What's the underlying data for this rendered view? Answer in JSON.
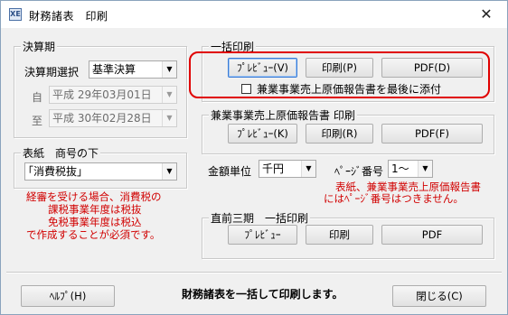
{
  "window": {
    "title": "財務諸表　印刷",
    "app_icon_text": "XE",
    "close_glyph": "✕"
  },
  "fiscal_period": {
    "group_label": "決算期",
    "select_label": "決算期選択",
    "select_value": "基準決算",
    "from_label": "自",
    "from_value": "平成 29年03月01日",
    "to_label": "至",
    "to_value": "平成 30年02月28日"
  },
  "cover": {
    "group_label": "表紙　商号の下",
    "select_value": "｢消費税抜｣"
  },
  "tax_note": {
    "line1": "経審を受ける場合、消費税の",
    "line2": "課税事業年度は税抜",
    "line3": "免税事業年度は税込",
    "line4": "で作成することが必須です。"
  },
  "batch_print": {
    "group_label": "一括印刷",
    "preview": "ﾌﾟﾚﾋﾞｭｰ(V)",
    "print": "印刷(P)",
    "pdf": "PDF(D)",
    "attach_label": "兼業事業売上原価報告書を最後に添付",
    "attach_checked": false
  },
  "cost_report": {
    "group_label": "兼業事業売上原価報告書 印刷",
    "preview": "ﾌﾟﾚﾋﾞｭｰ(K)",
    "print": "印刷(R)",
    "pdf": "PDF(F)"
  },
  "unit": {
    "label": "金額単位",
    "value": "千円"
  },
  "page_number": {
    "label": "ﾍﾟｰｼﾞ番号",
    "value": "1～"
  },
  "page_note": {
    "line1": "表紙、兼業事業売上原価報告書",
    "line2": "にはﾍﾟｰｼﾞ番号はつきません。"
  },
  "prev_three": {
    "group_label": "直前三期　一括印刷",
    "preview": "ﾌﾟﾚﾋﾞｭｰ",
    "print": "印刷",
    "pdf": "PDF"
  },
  "footer": {
    "help": "ﾍﾙﾌﾟ(H)",
    "status": "財務諸表を一括して印刷します。",
    "close": "閉じる(C)"
  }
}
